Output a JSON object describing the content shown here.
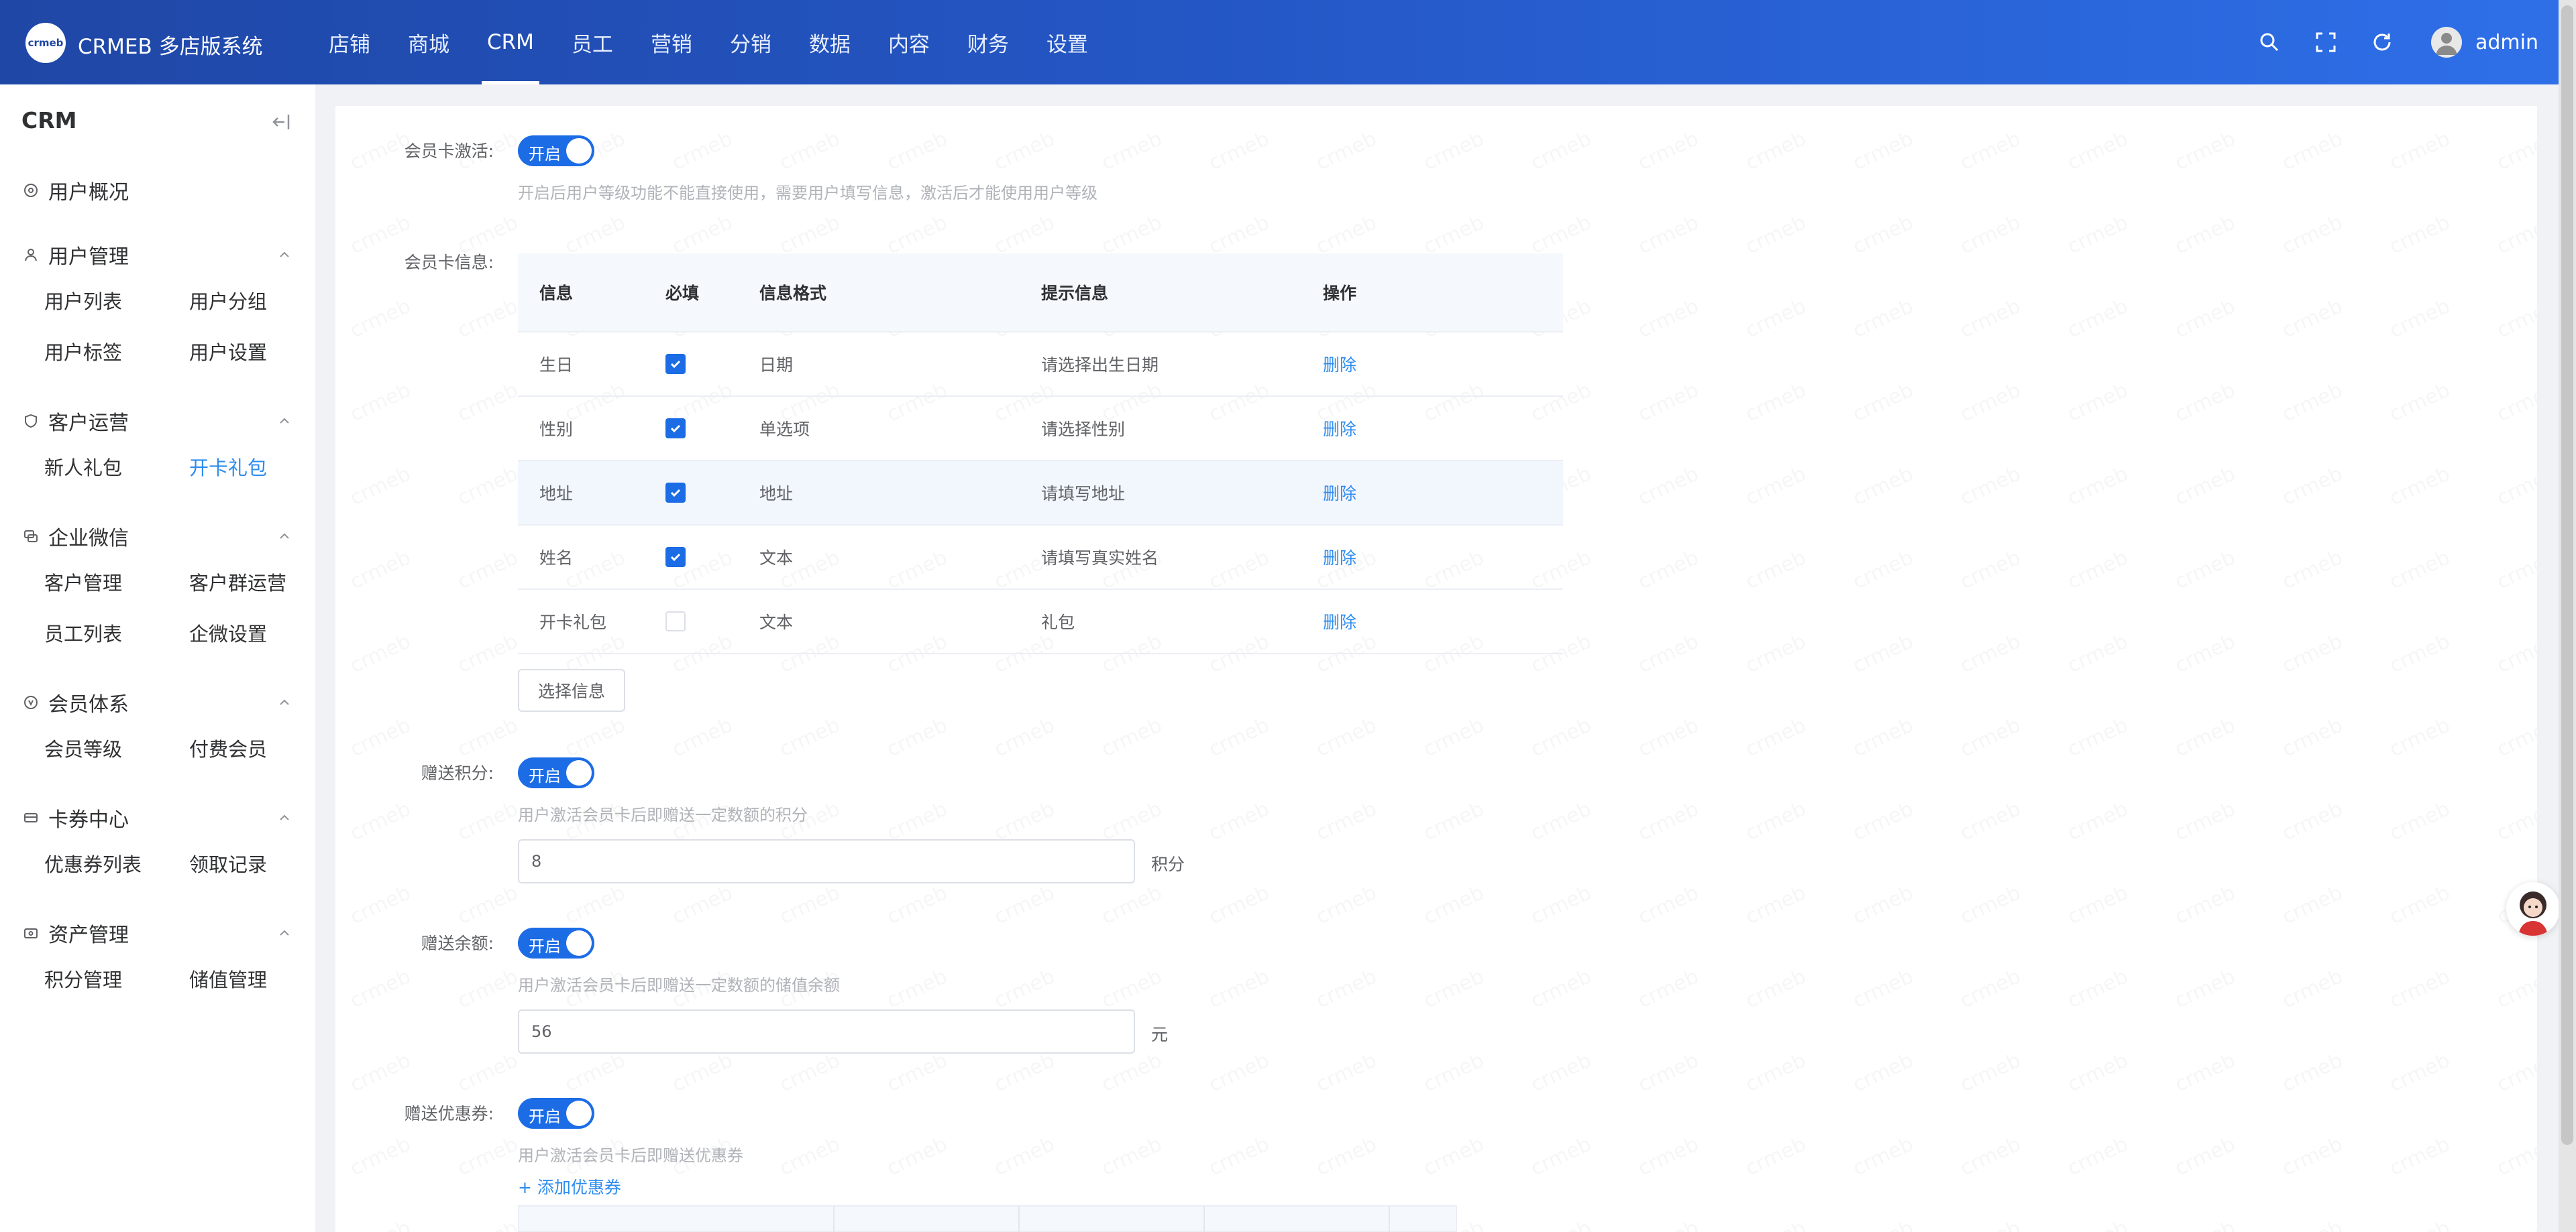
{
  "header": {
    "logo_text": "crmeb",
    "brand": "CRMEB 多店版系统",
    "nav": [
      "店铺",
      "商城",
      "CRM",
      "员工",
      "营销",
      "分销",
      "数据",
      "内容",
      "财务",
      "设置"
    ],
    "active_nav": "CRM",
    "username": "admin"
  },
  "sidebar": {
    "title": "CRM",
    "groups": [
      {
        "label": "用户概况",
        "icon": "dashboard-icon",
        "items": []
      },
      {
        "label": "用户管理",
        "icon": "user-icon",
        "items": [
          "用户列表",
          "用户分组",
          "用户标签",
          "用户设置"
        ]
      },
      {
        "label": "客户运营",
        "icon": "shield-icon",
        "items": [
          "新人礼包",
          "开卡礼包"
        ]
      },
      {
        "label": "企业微信",
        "icon": "chat-icon",
        "items": [
          "客户管理",
          "客户群运营",
          "员工列表",
          "企微设置"
        ]
      },
      {
        "label": "会员体系",
        "icon": "member-icon",
        "items": [
          "会员等级",
          "付费会员"
        ]
      },
      {
        "label": "卡券中心",
        "icon": "card-icon",
        "items": [
          "优惠券列表",
          "领取记录"
        ]
      },
      {
        "label": "资产管理",
        "icon": "wallet-icon",
        "items": [
          "积分管理",
          "储值管理"
        ]
      }
    ],
    "active_item": "开卡礼包"
  },
  "form": {
    "activate": {
      "label": "会员卡激活:",
      "switch": "开启",
      "hint": "开启后用户等级功能不能直接使用，需要用户填写信息，激活后才能使用用户等级"
    },
    "card_info": {
      "label": "会员卡信息:",
      "columns": [
        "信息",
        "必填",
        "信息格式",
        "提示信息",
        "操作"
      ],
      "rows": [
        {
          "info": "生日",
          "required": true,
          "format": "日期",
          "tip": "请选择出生日期",
          "action": "删除"
        },
        {
          "info": "性别",
          "required": true,
          "format": "单选项",
          "tip": "请选择性别",
          "action": "删除"
        },
        {
          "info": "地址",
          "required": true,
          "format": "地址",
          "tip": "请填写地址",
          "action": "删除"
        },
        {
          "info": "姓名",
          "required": true,
          "format": "文本",
          "tip": "请填写真实姓名",
          "action": "删除"
        },
        {
          "info": "开卡礼包",
          "required": false,
          "format": "文本",
          "tip": "礼包",
          "action": "删除"
        }
      ],
      "select_button": "选择信息"
    },
    "points": {
      "label": "赠送积分:",
      "switch": "开启",
      "hint": "用户激活会员卡后即赠送一定数额的积分",
      "value": "8",
      "unit": "积分"
    },
    "balance": {
      "label": "赠送余额:",
      "switch": "开启",
      "hint": "用户激活会员卡后即赠送一定数额的储值余额",
      "value": "56",
      "unit": "元"
    },
    "coupon": {
      "label": "赠送优惠券:",
      "switch": "开启",
      "hint": "用户激活会员卡后即赠送优惠券",
      "add_link": "+ 添加优惠券"
    }
  },
  "colors": {
    "primary": "#1c6ce6",
    "link": "#2d8cf0",
    "header_start": "#1f47a6",
    "header_end": "#2e6fe8"
  }
}
